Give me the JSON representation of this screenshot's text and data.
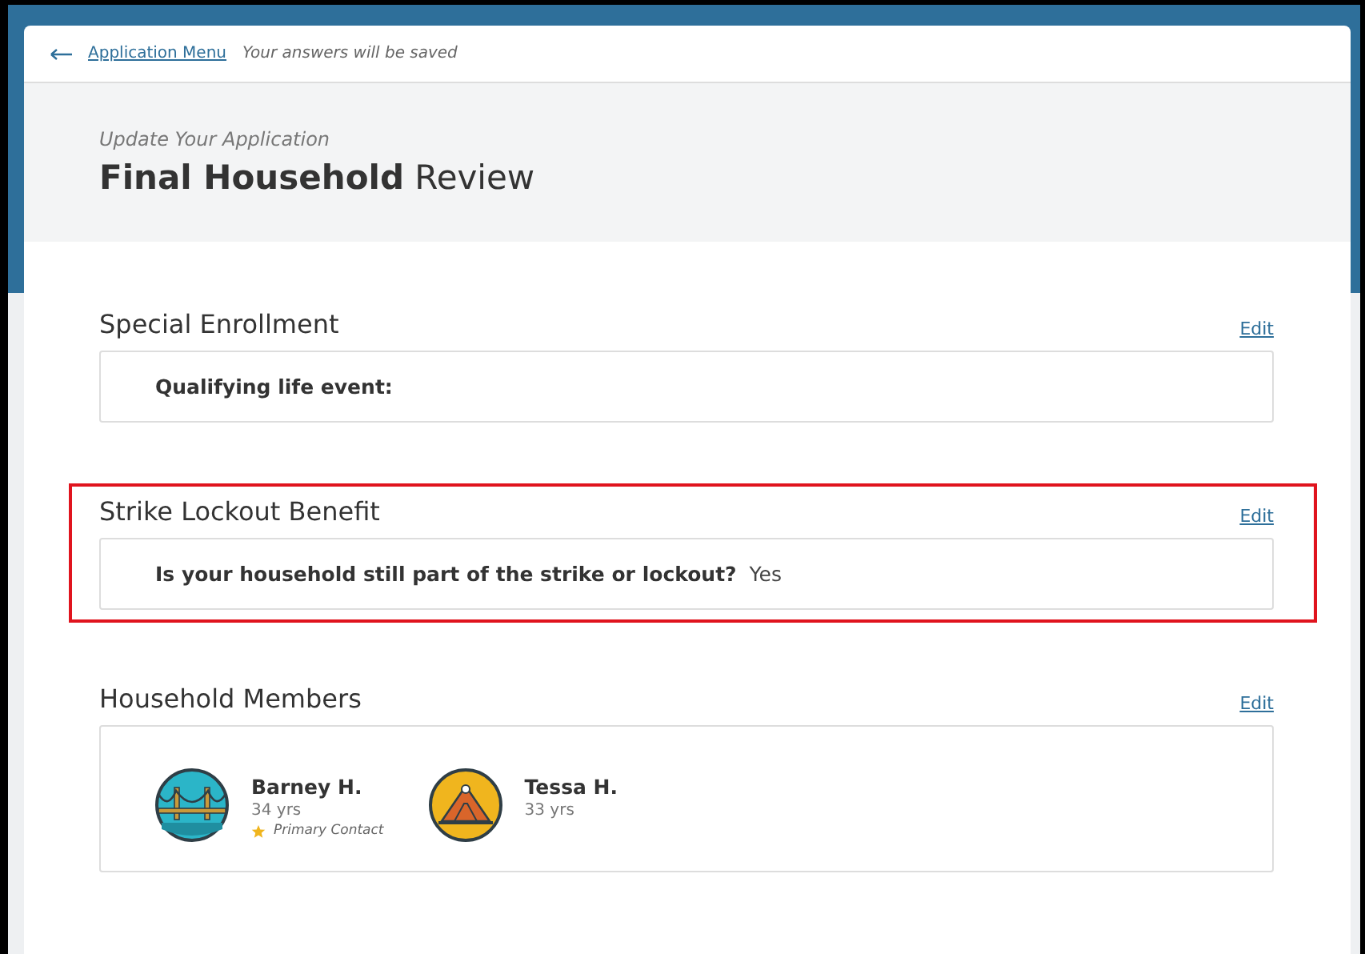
{
  "topbar": {
    "back_link": "Application Menu",
    "note": "Your answers will be saved"
  },
  "header": {
    "eyebrow": "Update Your Application",
    "title_bold": "Final Household",
    "title_rest": "Review"
  },
  "sections": [
    {
      "kind": "qa",
      "title": "Special Enrollment",
      "edit": "Edit",
      "highlighted": false,
      "question": "Qualifying life event:"
    },
    {
      "kind": "qa",
      "title": "Strike Lockout Benefit",
      "edit": "Edit",
      "highlighted": true,
      "question": "Is your household still part of the strike or lockout?",
      "answer": "Yes"
    },
    {
      "kind": "members",
      "title": "Household Members",
      "edit": "Edit",
      "highlighted": false,
      "members": [
        {
          "name": "Barney H.",
          "age": "34 yrs",
          "kind": "bridge",
          "badge": "Primary Contact"
        },
        {
          "name": "Tessa H.",
          "age": "33 yrs",
          "kind": "mountain"
        }
      ]
    }
  ]
}
